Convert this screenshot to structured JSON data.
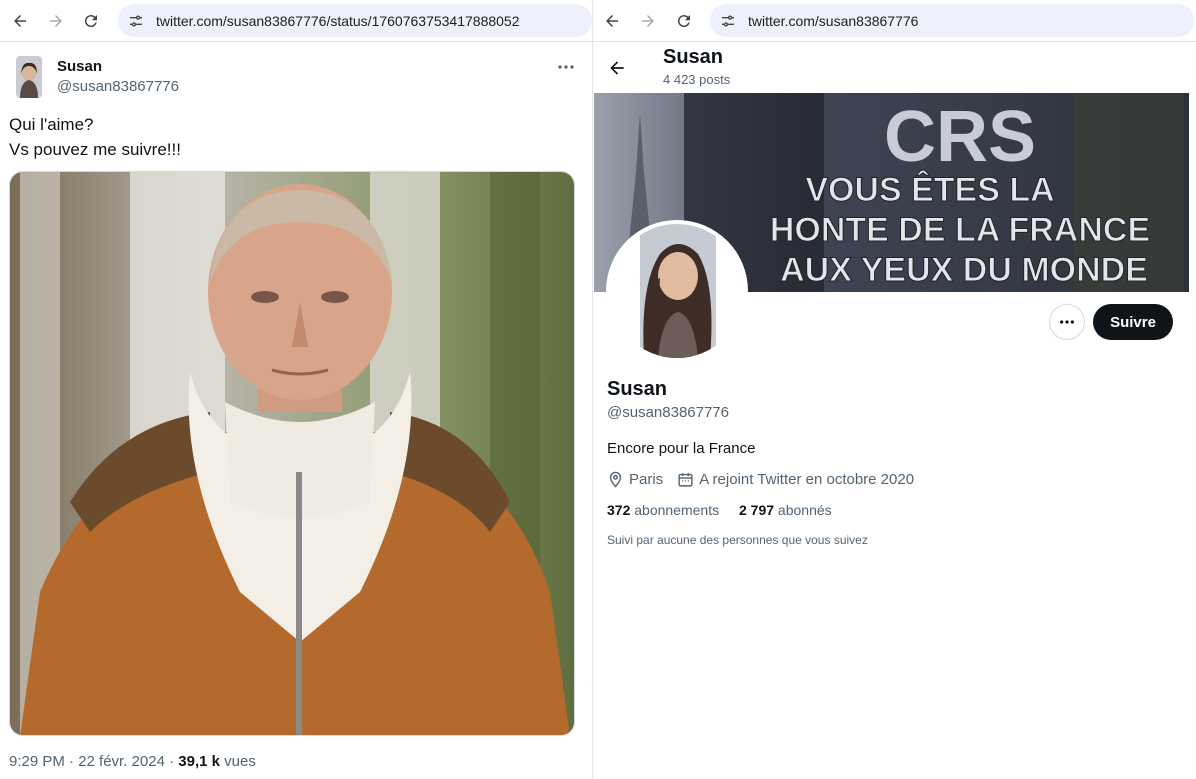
{
  "left": {
    "url": "twitter.com/susan83867776/status/1760763753417888052",
    "tweet": {
      "author_name": "Susan",
      "author_handle": "@susan83867776",
      "text_line1": "Qui l'aime?",
      "text_line2": "Vs pouvez me suivre!!!",
      "time": "9:29 PM · 22 févr. 2024 · ",
      "views_count": "39,1 k",
      "views_label": " vues"
    }
  },
  "right": {
    "url": "twitter.com/susan83867776",
    "header_name": "Susan",
    "header_posts": "4 423 posts",
    "banner": {
      "line1": "CRS",
      "line2": "VOUS ÊTES LA",
      "line3": "HONTE DE LA FRANCE",
      "line4": "AUX YEUX DU MONDE"
    },
    "follow_label": "Suivre",
    "name": "Susan",
    "handle": "@susan83867776",
    "bio": "Encore pour la France",
    "location": "Paris",
    "joined": "A rejoint Twitter en octobre 2020",
    "following_count": "372",
    "following_label": " abonnements",
    "followers_count": "2 797",
    "followers_label": " abonnés",
    "followed_by": "Suivi par aucune des personnes que vous suivez"
  },
  "icons": {
    "back": "arrow-left-icon",
    "forward": "arrow-right-icon",
    "reload": "reload-icon",
    "site_settings": "tune-icon",
    "more": "more-horizontal-icon",
    "location": "location-pin-icon",
    "calendar": "calendar-icon"
  },
  "colors": {
    "accent": "#0f1419",
    "secondary_text": "#536471",
    "url_bar": "#eef1fb"
  }
}
